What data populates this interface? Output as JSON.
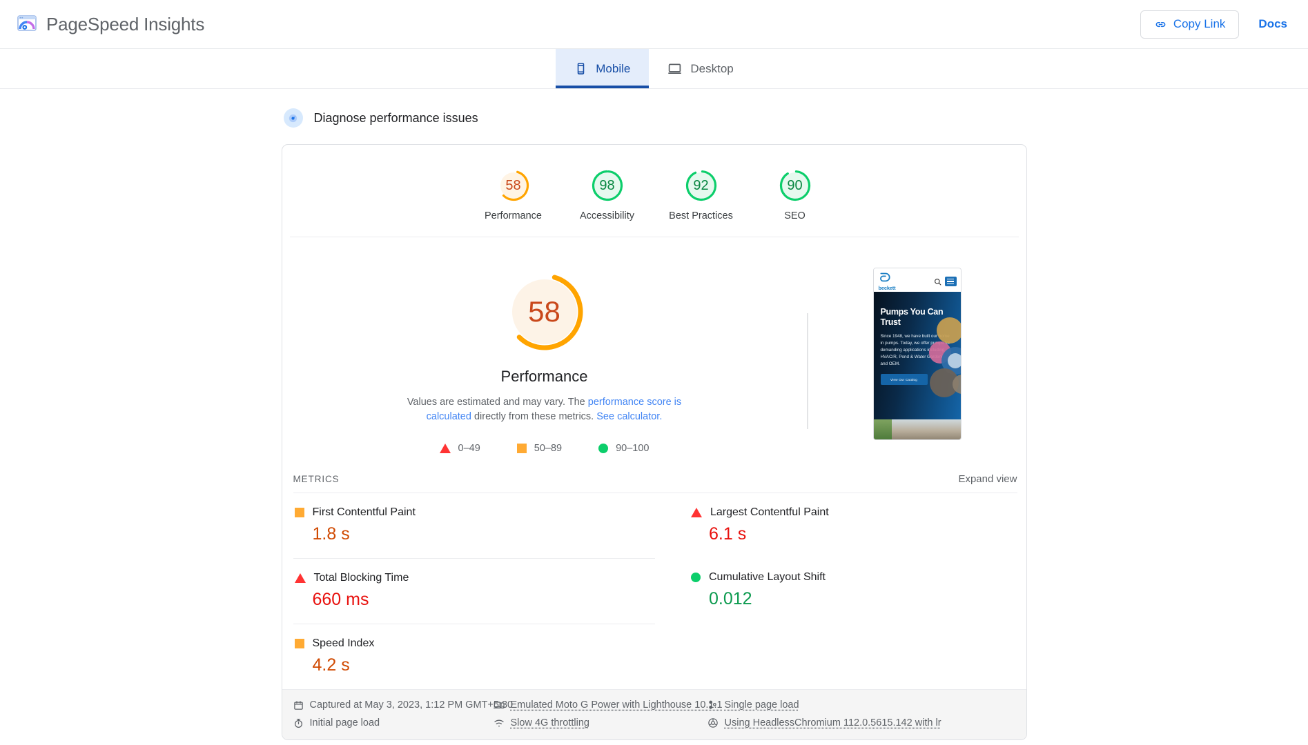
{
  "header": {
    "brand_title": "PageSpeed Insights",
    "brand_icon": "pagespeed-logo-icon",
    "copy_link_label": "Copy Link",
    "copy_link_icon": "link-icon",
    "docs_label": "Docs"
  },
  "tabs": [
    {
      "label": "Mobile",
      "icon": "phone-icon",
      "active": true
    },
    {
      "label": "Desktop",
      "icon": "monitor-icon",
      "active": false
    }
  ],
  "diagnose": {
    "label": "Diagnose performance issues",
    "icon": "diagnose-icon"
  },
  "scores": [
    {
      "label": "Performance",
      "value": "58",
      "color": "#ffa400",
      "fill": "#fff4e5",
      "text_color": "#c9481b",
      "pct": 58
    },
    {
      "label": "Accessibility",
      "value": "98",
      "color": "#0cce6b",
      "fill": "#e6f9ef",
      "text_color": "#088741",
      "pct": 98
    },
    {
      "label": "Best Practices",
      "value": "92",
      "color": "#0cce6b",
      "fill": "#e6f9ef",
      "text_color": "#088741",
      "pct": 92
    },
    {
      "label": "SEO",
      "value": "90",
      "color": "#0cce6b",
      "fill": "#e6f9ef",
      "text_color": "#088741",
      "pct": 90
    }
  ],
  "hero": {
    "gauge_value": "58",
    "gauge_color": "#ffa400",
    "gauge_fill": "#fdf3e7",
    "gauge_text_color": "#c9481b",
    "gauge_pct": 58,
    "metric_label": "Performance",
    "desc_part1": "Values are estimated and may vary. The ",
    "desc_link1": "performance score is calculated",
    "desc_part2": " directly from these metrics. ",
    "desc_link2": "See calculator."
  },
  "legend": [
    {
      "shape": "triangle",
      "range": "0–49",
      "color": "#ff3333"
    },
    {
      "shape": "square",
      "range": "50–89",
      "color": "#ffaa33"
    },
    {
      "shape": "circle",
      "range": "90–100",
      "color": "#0cce6b"
    }
  ],
  "thumbnail": {
    "brand": "beckett",
    "headline": "Pumps You Can Trust",
    "body": "Since 1948, we have built our home in pumps. Today, we offer pumps for demanding applications including HVAC/R, Pond & Water Gardening and OEM.",
    "cta": "View Our Catalog",
    "search_icon": "search-icon",
    "menu_icon": "hamburger-menu-icon"
  },
  "metrics_section": {
    "title": "METRICS",
    "expand_label": "Expand view"
  },
  "metrics": [
    {
      "label": "First Contentful Paint",
      "value": "1.8 s",
      "shape": "square",
      "color": "#ffaa33",
      "value_color": "#d04a02"
    },
    {
      "label": "Largest Contentful Paint",
      "value": "6.1 s",
      "shape": "triangle",
      "color": "#ff3333",
      "value_color": "#e8100d"
    },
    {
      "label": "Total Blocking Time",
      "value": "660 ms",
      "shape": "triangle",
      "color": "#ff3333",
      "value_color": "#e8100d"
    },
    {
      "label": "Cumulative Layout Shift",
      "value": "0.012",
      "shape": "circle",
      "color": "#0cce6b",
      "value_color": "#0b9a4e"
    },
    {
      "label": "Speed Index",
      "value": "4.2 s",
      "shape": "square",
      "color": "#ffaa33",
      "value_color": "#d04a02"
    }
  ],
  "meta": [
    {
      "text": "Captured at May 3, 2023, 1:12 PM GMT+5:30",
      "icon": "calendar-icon",
      "link": false
    },
    {
      "text": "Emulated Moto G Power with Lighthouse 10.1.1",
      "icon": "device-icon",
      "link": true
    },
    {
      "text": "Single page load",
      "icon": "single-load-icon",
      "link": true
    },
    {
      "text": "Initial page load",
      "icon": "stopwatch-icon",
      "link": false
    },
    {
      "text": "Slow 4G throttling",
      "icon": "wifi-icon",
      "link": true
    },
    {
      "text": "Using HeadlessChromium 112.0.5615.142 with lr",
      "icon": "chrome-icon",
      "link": true
    }
  ]
}
